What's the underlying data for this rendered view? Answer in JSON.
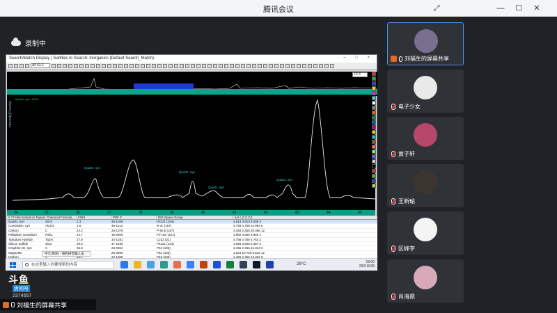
{
  "window": {
    "title": "腾讯会议"
  },
  "recording": {
    "label": "录制中"
  },
  "shared_app": {
    "title": "Search/Match Display  | Subfiles to Search: Inorganics (Default Search_Match)",
    "window_buttons": "– □ ×",
    "toolbar_select": "All 63.2",
    "zoom_value": "10.3",
    "pdf_label": "Quartz, syn - SiO2",
    "y_axis_label": "Intensity(Counts)",
    "peak_labels": [
      "Quartz, syn",
      "Quartz, syn",
      "Quartz, syn",
      "Quartz, syn"
    ],
    "x_ticks": [
      "34",
      "35",
      "36",
      "37",
      "38",
      "39",
      "40",
      "41",
      "42",
      "43",
      "44",
      "45"
    ],
    "table_headers": [
      "# 77 Hits Sorted on Figure-Of-M",
      "Chemical Formula",
      "FOM",
      "PDF #",
      "RIR  Space Group",
      "a  b  c  Z  S  CS"
    ],
    "table_rows": [
      [
        "Quartz, syn",
        "SiO2",
        "1.3",
        "46-1045",
        "P3221 (154)",
        "4.913  4.913  5.405  3"
      ],
      [
        "Coesinden, syn",
        "Al2O3",
        "1.6",
        "46-1212",
        "R-3c (167)",
        "4.758  4.758  12.993  6"
      ],
      [
        "Carbon",
        "C",
        "22.2",
        "26-1076",
        "P-6m2 (187)",
        "2.456  2.456  20.088  12"
      ],
      [
        "Palladium Scandium",
        "PdSc",
        "24.7",
        "18-0900",
        "Pm-3m (221)",
        "3.960  3.960  3.960  1"
      ],
      [
        "Tantalum Hydride",
        "TaZH",
        "27.9",
        "32-1281",
        "C222 (21)",
        "4.758  4.758  4.763  2"
      ],
      [
        "Silicon Sulfide",
        "SiS2",
        "29.5",
        "47-1536",
        "P4221 (134)",
        "4.928  4.928  5.487  2"
      ],
      [
        "Graphite 2H, syn",
        "C",
        "35.9",
        "23-0064",
        "P63 (186)",
        "2.456  2.456  10.044  6"
      ],
      [
        "Magnetite",
        "C",
        "37.7",
        "26-0909",
        "P63 (186)",
        "4.924  10.760  8.533  12"
      ],
      [
        "Carbon",
        "C",
        "39.1",
        "22-1069",
        "P63 (186)",
        "2.456  2.456  13.362  6"
      ]
    ],
    "status_text": "2θ: 33.8073   d=8.5273   I=7975   2θ, 1.TheMa (or)   ADF  Pbt  Unoun"
  },
  "ime_bar": "中文(简体) - 搜狗拼音输入法",
  "taskbar": {
    "search_placeholder": "在这里输入你要搜索的内容",
    "weather": "28°C",
    "time": "19:00",
    "date": "2021/5/28"
  },
  "overlay": {
    "logo": "斗鱼",
    "room_badge": "房间号",
    "room_id": "2374557",
    "sharer_label": "刘福生的屏幕共享"
  },
  "participants": [
    {
      "name": "刘福生的屏幕共享",
      "avatar_color": "#7a6f8f",
      "icon": "mic-icon",
      "sharing": true
    },
    {
      "name": "电子少女",
      "avatar_color": "#e9e9ea",
      "icon": "mute-icon"
    },
    {
      "name": "黄子轩",
      "avatar_color": "#b4476a",
      "icon": "mute-icon"
    },
    {
      "name": "王新瑜",
      "avatar_color": "#3b3530",
      "icon": "mute-icon"
    },
    {
      "name": "区峰字",
      "avatar_color": "#f4f4f4",
      "icon": "mute-icon"
    },
    {
      "name": "肖海鼎",
      "avatar_color": "#d8a9b8",
      "icon": "mute-icon"
    }
  ]
}
